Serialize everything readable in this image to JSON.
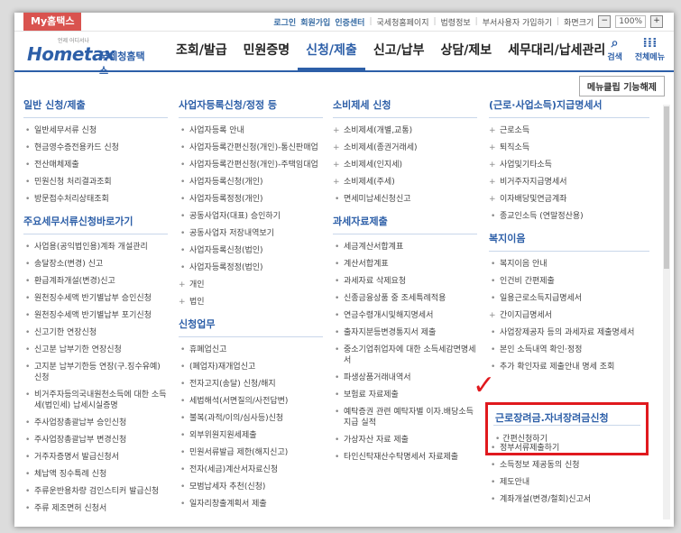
{
  "util": {
    "my_tab": "My홈택스",
    "links": [
      "로그인",
      "회원가입",
      "인증센터",
      "국세청홈페이지",
      "법령정보",
      "부서사용자 가입하기",
      "화면크기"
    ],
    "zoom_minus": "−",
    "zoom_value": "100%",
    "zoom_plus": "+"
  },
  "gnb": {
    "logo_small": "언제 어디서나",
    "logo_main": "Hometax",
    "logo_sub": "국세청홈택스",
    "menu": [
      "조회/발급",
      "민원증명",
      "신청/제출",
      "신고/납부",
      "상담/제보",
      "세무대리/납세관리"
    ],
    "active_menu": "신청/제출",
    "search_label": "검색",
    "all_menu_label": "전체메뉴"
  },
  "unlock_button": "메뉴클립 기능해제",
  "col1": {
    "title1": "일반 신청/제출",
    "items1": [
      "일반세무서류 신청",
      "현금영수증전용카드 신청",
      "전산매체제출",
      "민원신청 처리결과조회",
      "방문접수처리상태조회"
    ],
    "title2": "주요세무서류신청바로가기",
    "items2": [
      "사업용(공익법인용)계좌 개설관리",
      "송달장소(변경) 신고",
      "환급계좌개설(변경)신고",
      "원천징수세액 반기별납부 승인신청",
      "원천징수세액 반기별납부 포기신청",
      "신고기한 연장신청",
      "신고분 납부기한 연장신청",
      "고지분 납부기한등 연장(구.징수유예) 신청",
      "비거주자등의국내원천소득에 대한 소득세(법인세) 납세시실증명",
      "주사업장총괄납부 승인신청",
      "주사업장총괄납부 변경신청",
      "거주자증명서 발급신청서",
      "체납액 징수특례 신청",
      "주류운반용차량 검인스티커 발급신청",
      "주류 제조면허 신청서"
    ]
  },
  "col2": {
    "title1": "사업자등록신청/정정 등",
    "items1": [
      "사업자등록 안내",
      "사업자등록간편신청(개인)-통신판매업",
      "사업자등록간편신청(개인)-주택임대업",
      "사업자등록신청(개인)",
      "사업자등록정정(개인)",
      "공동사업자(대표) 승인하기",
      "공동사업자 저장내역보기",
      "사업자등록신청(법인)",
      "사업자등록정정(법인)"
    ],
    "plus1": [
      "개인",
      "법인"
    ],
    "title2": "신청업무",
    "items2": [
      "휴폐업신고",
      "(폐업자)재개업신고",
      "전자고지(송달) 신청/해지",
      "세법해석(서면질의/사전답변)",
      "불복(과적/이의/심사등)신청",
      "외부위원지원세제출",
      "민원서류발급 제한(해지신고)",
      "전자(세금)계산서자료신청",
      "모범납세자 추천(신청)",
      "일자리창출계획서 제출"
    ]
  },
  "col3": {
    "title1": "소비제세 신청",
    "plus1": [
      "소비제세(개별,교통)",
      "소비제세(종권거래세)",
      "소비제세(인지세)",
      "소비제세(주세)"
    ],
    "items1": [
      "면세미납세신청신고"
    ],
    "title2": "과세자료제출",
    "items2": [
      "세금계산서합계표",
      "계산서합계표",
      "과세자료 삭제요청",
      "신종금융상품 중 조세특례적용",
      "연금수령개시및해지명세서",
      "출자지분등변경통지서 제출",
      "중소기업취업자에 대한 소득세감면명세서",
      "파생상품거래내역서",
      "보험료 자료제출",
      "예탁증권 관련 예탁자별 이자.배당소득지급 실적",
      "가상자산 자료 제출",
      "타인신탁재산수탁명세서 자료제출"
    ]
  },
  "col4": {
    "title1": "(근로·사업소득)지급명세서",
    "plus1": [
      "근로소득",
      "퇴직소득",
      "사업및기타소득",
      "비거주자지급명세서",
      "이자배당및연금계좌"
    ],
    "items1": [
      "종교인소득 (연말정산용)"
    ],
    "title2": "복지이음",
    "items2": [
      "복지이음 안내",
      "인건비 간편제출",
      "일용근로소득지급명세서"
    ],
    "plus2": [
      "간이지급명세서"
    ],
    "items3": [
      "사업장제공자 등의 과세자료 제출명세서",
      "본인 소득내역 확인·정정",
      "추가 확인자료 제출안내 명세 조회"
    ],
    "highlight_title": "근로장려금.자녀장려금신청",
    "highlight_item": "간편신청하기",
    "items4": [
      "정부서류제출하기",
      "소득정보 제공동의 신청",
      "제도안내",
      "계좌개설(변경/철회)신고서"
    ]
  },
  "colors": {
    "accent": "#2d5fa8",
    "highlight": "#e0191e",
    "my_tab": "#d9534f"
  }
}
